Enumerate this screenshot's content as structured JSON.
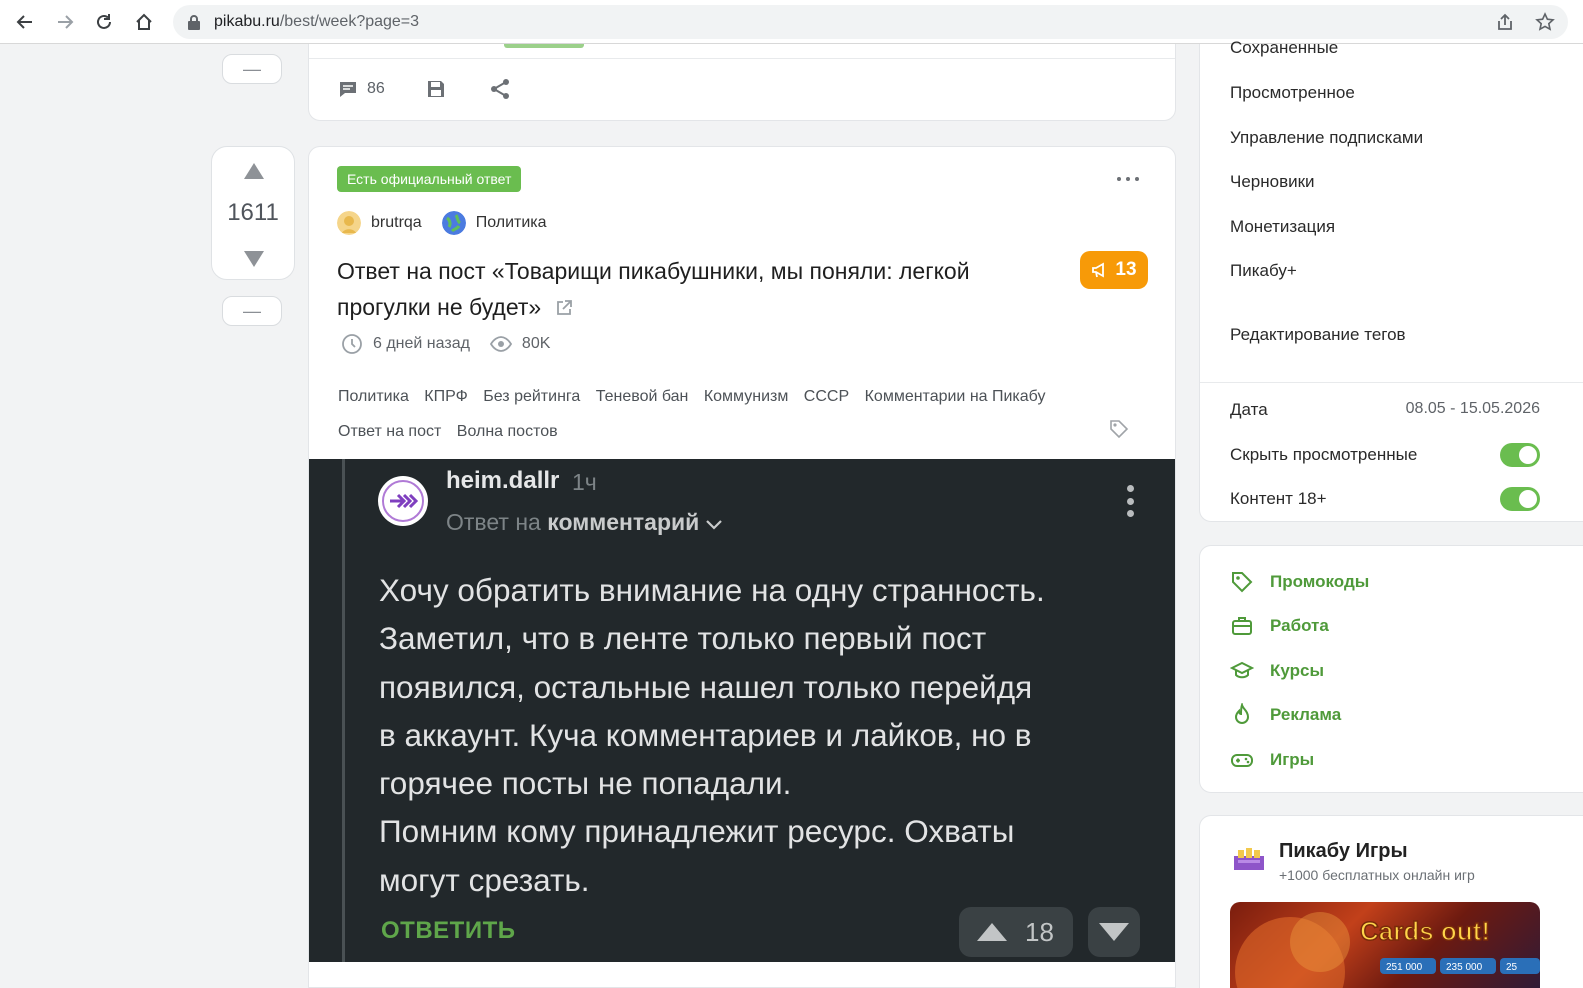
{
  "browser": {
    "url_host": "pikabu.ru",
    "url_path": "/best/week?page=3"
  },
  "prev_story": {
    "comments_count": "86"
  },
  "story": {
    "official_badge": "Есть официальный ответ",
    "author": "brutrqa",
    "community": "Политика",
    "title": "Ответ на пост «Товарищи пикабушники, мы поняли: легкой прогулки не будет»",
    "rating": "1611",
    "comments_badge": "13",
    "time": "6 дней назад",
    "views": "80K",
    "tags": [
      "Политика",
      "КПРФ",
      "Без рейтинга",
      "Теневой бан",
      "Коммунизм",
      "СССР",
      "Комментарии на Пикабу",
      "Ответ на пост",
      "Волна постов"
    ]
  },
  "screenshot": {
    "username": "heim.dallr",
    "time": "1ч",
    "reply_prefix": "Ответ на",
    "reply_target": "комментарий",
    "text_lines": [
      "Хочу обратить внимание на одну странность.",
      "Заметил, что в ленте только первый пост",
      "появился, остальные нашел только перейдя",
      "в аккаунт. Куча комментариев и лайков, но в",
      "горячее посты не попадали.",
      "Помним кому принадлежит ресурс. Охваты",
      "могут срезать."
    ],
    "answer_label": "ОТВЕТИТЬ",
    "votes": "18"
  },
  "sidebar": {
    "menu": {
      "saved": "Сохраненные",
      "viewed": "Просмотренное",
      "subscriptions": "Управление подписками",
      "drafts": "Черновики",
      "monetization": "Монетизация",
      "pikabu_plus": "Пикабу+",
      "edit_tags": "Редактирование тегов"
    },
    "filters": {
      "date_label": "Дата",
      "date_value": "08.05 - 15.05.2026",
      "hide_viewed_label": "Скрыть просмотренные",
      "hide_viewed_on": true,
      "adult_label": "Контент 18+",
      "adult_on": true
    },
    "links": {
      "promo": "Промокоды",
      "jobs": "Работа",
      "courses": "Курсы",
      "ads": "Реклама",
      "games": "Игры"
    },
    "games_block": {
      "title": "Пикабу Игры",
      "subtitle": "+1000 бесплатных онлайн игр",
      "banner_text": "Cards out!",
      "banner_chips": [
        "251 000",
        "235 000",
        "25"
      ]
    }
  },
  "colors": {
    "accent_green": "#6abd4f",
    "link_green": "#4f9a3a",
    "rating_orange": "#f79a08",
    "screenshot_bg": "#22282b"
  }
}
